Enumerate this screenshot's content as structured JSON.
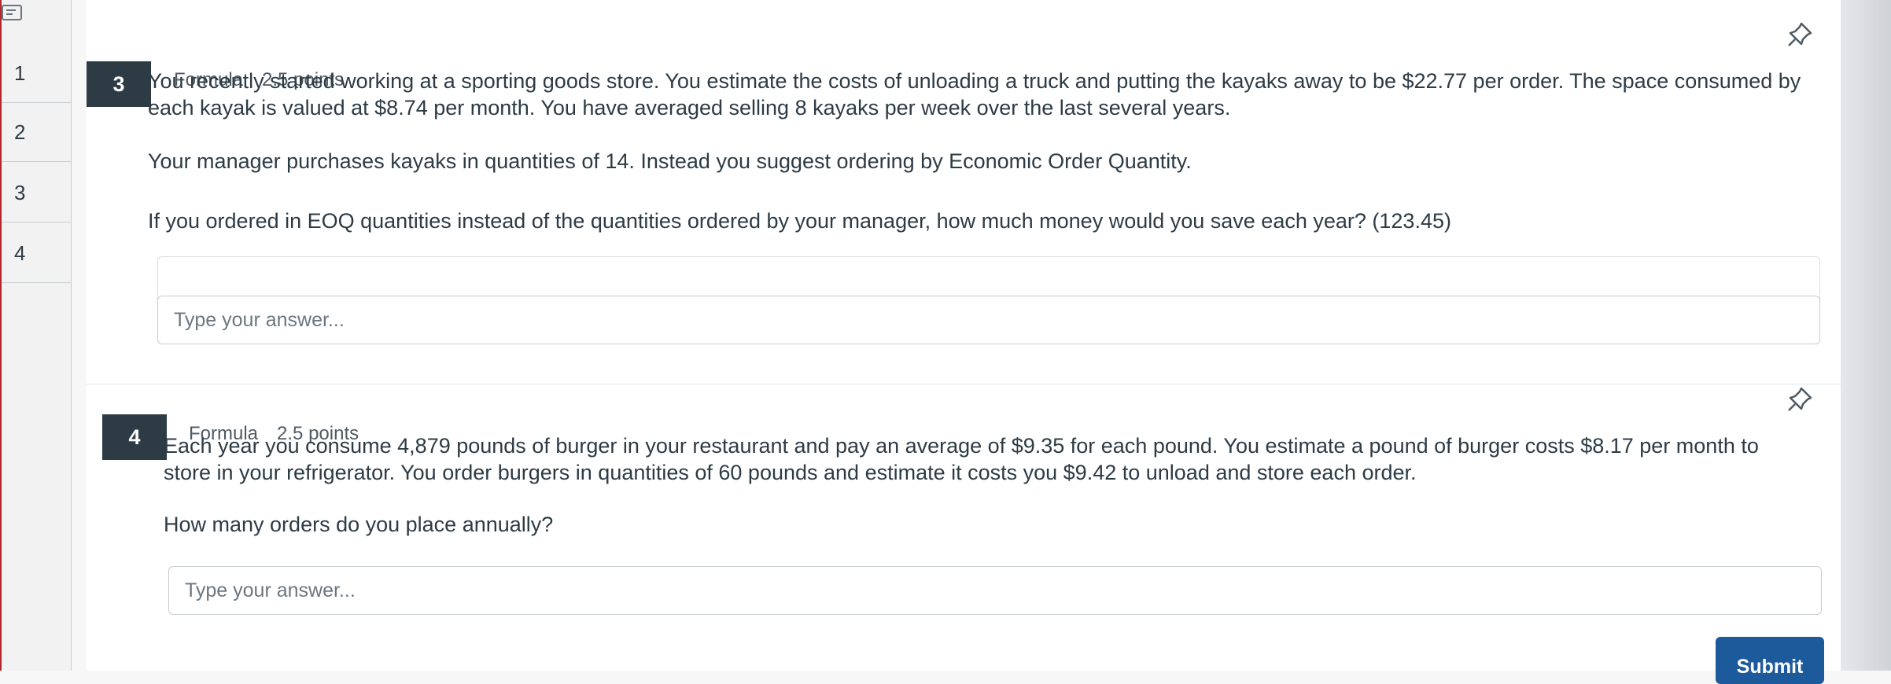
{
  "sidebar": {
    "items": [
      {
        "label": "1"
      },
      {
        "label": "2"
      },
      {
        "label": "3"
      },
      {
        "label": "4"
      }
    ]
  },
  "questions": [
    {
      "number": "3",
      "type": "Formula",
      "points": "2.5 points",
      "paragraphs": [
        "You recently started working at a sporting goods store. You estimate the costs of unloading a truck and putting the kayaks away to be $22.77 per order. The space consumed by each kayak is valued at $8.74 per month.  You have averaged selling 8 kayaks per week over the last several years.",
        "Your manager purchases kayaks in quantities of 14. Instead you suggest ordering by Economic Order Quantity.",
        "If you ordered in EOQ quantities instead of the quantities ordered by your manager, how much money would you save each year? (123.45)"
      ],
      "answer_placeholder": "Type your answer...",
      "answer_value": ""
    },
    {
      "number": "4",
      "type": "Formula",
      "points": "2.5 points",
      "paragraphs": [
        "Each year you consume 4,879 pounds of burger in your restaurant and pay an average of $9.35 for each pound. You estimate a pound of burger costs $8.17 per month to store in your refrigerator. You order burgers in quantities of 60 pounds and estimate it costs you $9.42 to unload and store each order.",
        "How many orders do you place annually?"
      ],
      "answer_placeholder": "Type your answer...",
      "answer_value": ""
    }
  ],
  "submit_label": "Submit",
  "colors": {
    "accent": "#1d5a9b",
    "qnum_bg": "#2d3b45",
    "text": "#2d3b45"
  },
  "icons": {
    "sidebar_toggle": "list-icon",
    "pin": "pin-icon"
  }
}
